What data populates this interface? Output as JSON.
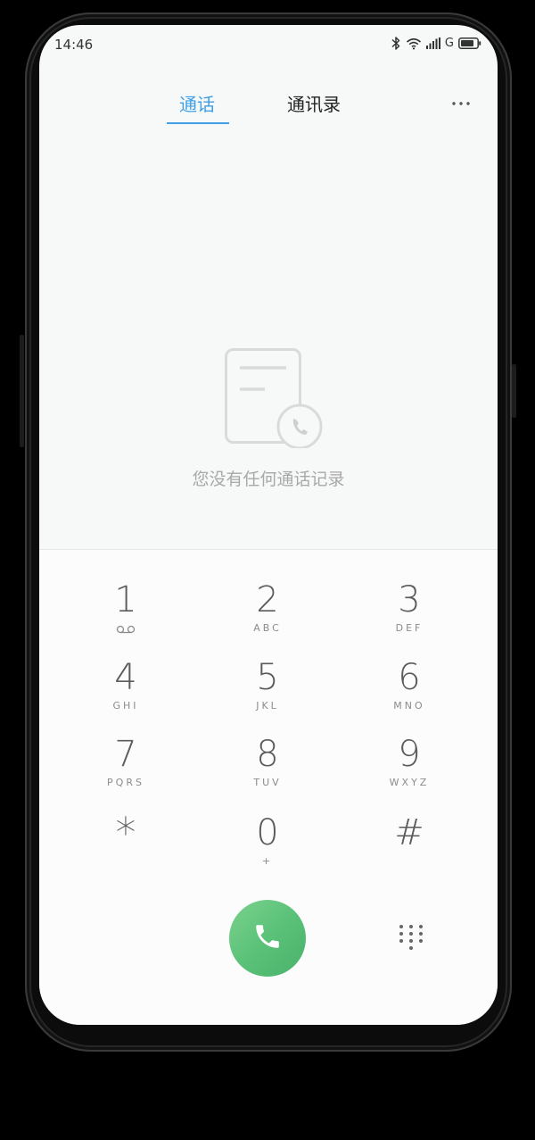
{
  "status_bar": {
    "time": "14:46",
    "network": "G",
    "icons": [
      "bluetooth-icon",
      "wifi-icon",
      "signal-icon",
      "battery-icon"
    ]
  },
  "tabs": [
    {
      "label": "通话",
      "active": true
    },
    {
      "label": "通讯录",
      "active": false
    }
  ],
  "empty_state": {
    "message": "您没有任何通话记录"
  },
  "keypad": {
    "keys": [
      {
        "digit": "1",
        "letters": ""
      },
      {
        "digit": "2",
        "letters": "ABC"
      },
      {
        "digit": "3",
        "letters": "DEF"
      },
      {
        "digit": "4",
        "letters": "GHI"
      },
      {
        "digit": "5",
        "letters": "JKL"
      },
      {
        "digit": "6",
        "letters": "MNO"
      },
      {
        "digit": "7",
        "letters": "PQRS"
      },
      {
        "digit": "8",
        "letters": "TUV"
      },
      {
        "digit": "9",
        "letters": "WXYZ"
      },
      {
        "digit": "*",
        "letters": ""
      },
      {
        "digit": "0",
        "letters": "+"
      },
      {
        "digit": "#",
        "letters": ""
      }
    ]
  },
  "colors": {
    "accent": "#3fa0e6",
    "call_green": "#58c077"
  }
}
